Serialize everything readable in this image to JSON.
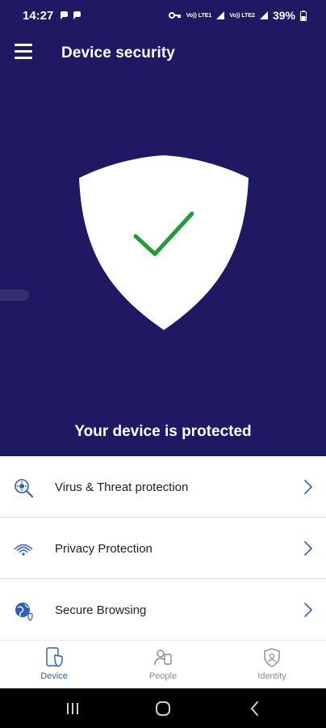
{
  "status_bar": {
    "time": "14:27",
    "battery": "39%",
    "signal_text_1": "Vo)) LTE1",
    "signal_text_2": "Vo)) LTE2"
  },
  "header": {
    "title": "Device security",
    "menu_icon": "hamburger-menu-icon"
  },
  "hero": {
    "status_message": "Your device is protected",
    "shield_icon": "shield-check-icon"
  },
  "features": [
    {
      "label": "Virus & Threat protection",
      "icon": "virus-scan-icon"
    },
    {
      "label": "Privacy Protection",
      "icon": "wifi-privacy-icon"
    },
    {
      "label": "Secure Browsing",
      "icon": "globe-shield-icon"
    }
  ],
  "bottom_nav": [
    {
      "label": "Device",
      "icon": "device-shield-icon",
      "active": true
    },
    {
      "label": "People",
      "icon": "people-icon",
      "active": false
    },
    {
      "label": "Identity",
      "icon": "identity-shield-icon",
      "active": false
    }
  ],
  "colors": {
    "hero_bg": "#1f1963",
    "accent": "#2f5db8",
    "check_green": "#1e9e3a"
  }
}
